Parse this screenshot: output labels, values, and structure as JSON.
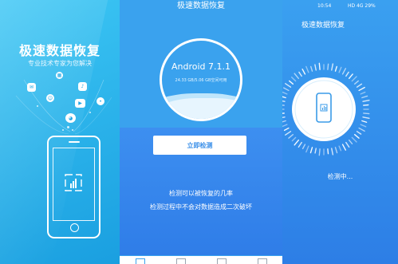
{
  "splash": {
    "title": "极速数据恢复",
    "subtitle": "专业技术专家为您解决",
    "icons": [
      "message-icon",
      "image-icon",
      "music-icon",
      "video-icon",
      "contacts-icon",
      "wechat-icon",
      "chat-icon"
    ]
  },
  "main": {
    "header_title": "极速数据恢复",
    "android_version": "Android 7.1.1",
    "storage_text": "24.33 GB/5.06 GB空间可用",
    "detect_button": "立即检测",
    "note_line1": "检测可以被恢复的几率",
    "note_line2": "检测过程中不会对数据造成二次破坏",
    "tabs": [
      "home-tab-icon",
      "records-tab-icon",
      "service-tab-icon",
      "help-tab-icon"
    ]
  },
  "scan": {
    "status_time": "10:54",
    "status_icons": "HD 4G 29%",
    "header_title": "极速数据恢复",
    "progress_label": "检测中..."
  },
  "colors": {
    "splash_bg": "#1fa6e6",
    "main_bg": "#3aa2ee",
    "button_text": "#3a8fe8",
    "white": "#ffffff"
  }
}
